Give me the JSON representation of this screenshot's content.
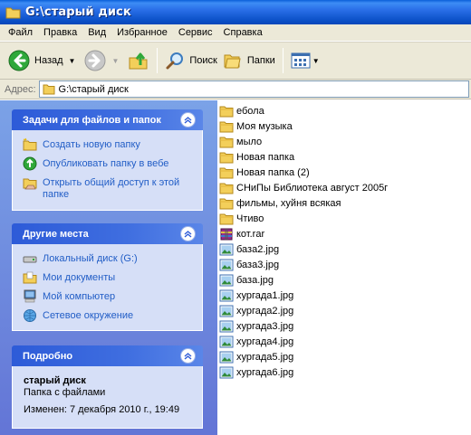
{
  "window": {
    "title": "G:\\старый диск"
  },
  "menu": [
    "Файл",
    "Правка",
    "Вид",
    "Избранное",
    "Сервис",
    "Справка"
  ],
  "toolbar": {
    "back_label": "Назад",
    "search_label": "Поиск",
    "folders_label": "Папки"
  },
  "address": {
    "label": "Адрес:",
    "value": "G:\\старый диск"
  },
  "tasks_panel": {
    "title": "Задачи для файлов и папок",
    "items": [
      "Создать новую папку",
      "Опубликовать папку в вебе",
      "Открыть общий доступ к этой папке"
    ]
  },
  "places_panel": {
    "title": "Другие места",
    "items": [
      "Локальный диск (G:)",
      "Мои документы",
      "Мой компьютер",
      "Сетевое окружение"
    ]
  },
  "details_panel": {
    "title": "Подробно",
    "name": "старый диск",
    "type": "Папка с файлами",
    "modified": "Изменен: 7 декабря 2010 г., 19:49"
  },
  "files": [
    {
      "name": "ебола",
      "kind": "folder"
    },
    {
      "name": "Моя музыка",
      "kind": "folder"
    },
    {
      "name": "мыло",
      "kind": "folder"
    },
    {
      "name": "Новая папка",
      "kind": "folder"
    },
    {
      "name": "Новая папка (2)",
      "kind": "folder"
    },
    {
      "name": "СНиПы Библиотека август 2005г",
      "kind": "folder"
    },
    {
      "name": "фильмы, хуйня всякая",
      "kind": "folder"
    },
    {
      "name": "Чтиво",
      "kind": "folder"
    },
    {
      "name": "кот.rar",
      "kind": "archive"
    },
    {
      "name": "база2.jpg",
      "kind": "image"
    },
    {
      "name": "база3.jpg",
      "kind": "image"
    },
    {
      "name": "база.jpg",
      "kind": "image"
    },
    {
      "name": "хургада1.jpg",
      "kind": "image"
    },
    {
      "name": "хургада2.jpg",
      "kind": "image"
    },
    {
      "name": "хургада3.jpg",
      "kind": "image"
    },
    {
      "name": "хургада4.jpg",
      "kind": "image"
    },
    {
      "name": "хургада5.jpg",
      "kind": "image"
    },
    {
      "name": "хургада6.jpg",
      "kind": "image"
    }
  ]
}
